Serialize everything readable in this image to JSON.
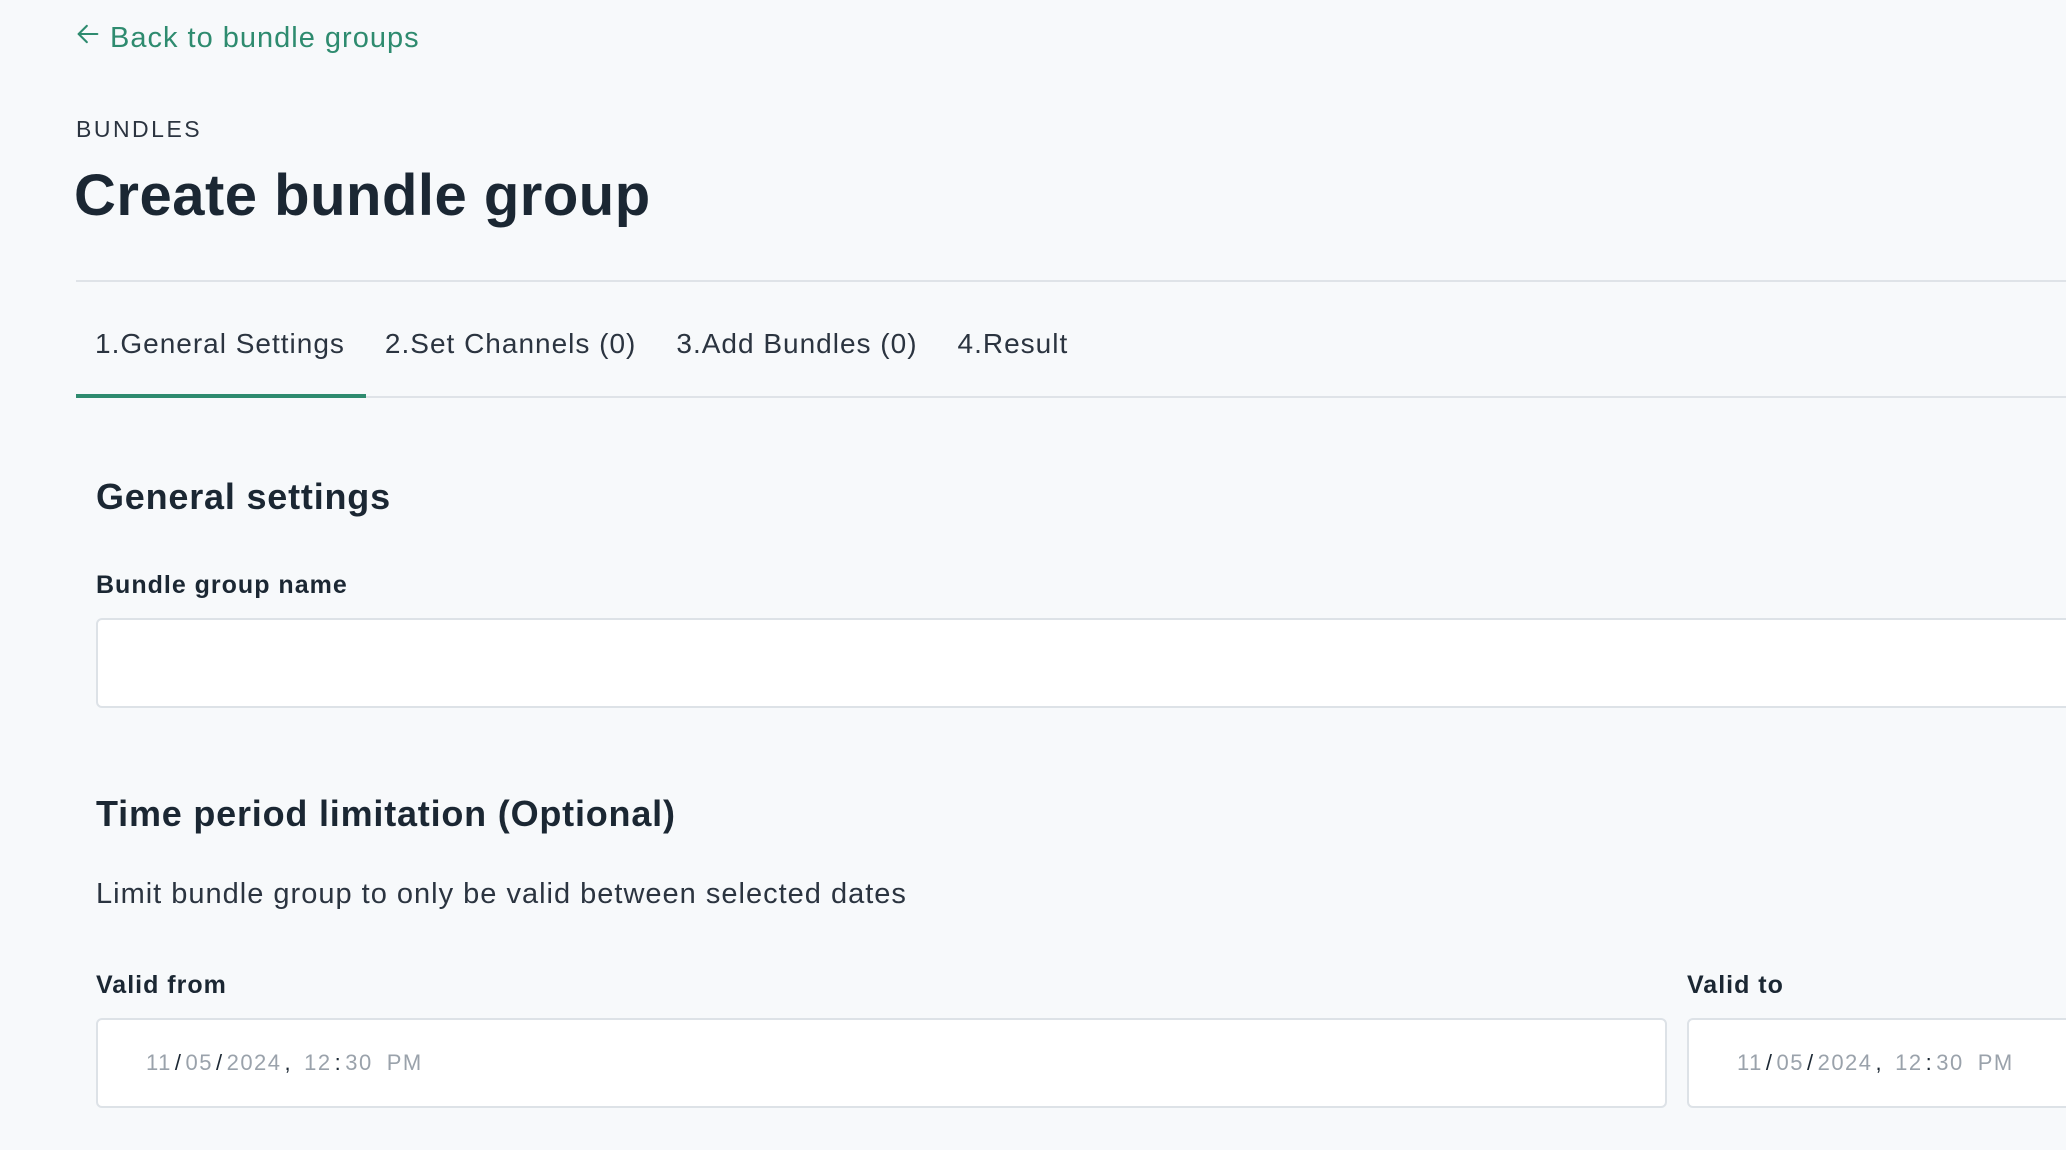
{
  "nav": {
    "back_label": "Back to bundle groups"
  },
  "header": {
    "eyebrow": "BUNDLES",
    "title": "Create bundle group"
  },
  "tabs": [
    {
      "label": "1.General Settings",
      "active": true
    },
    {
      "label": "2.Set Channels (0)",
      "active": false
    },
    {
      "label": "3.Add Bundles (0)",
      "active": false
    },
    {
      "label": "4.Result",
      "active": false
    }
  ],
  "general": {
    "heading": "General settings",
    "name_label": "Bundle group name",
    "name_value": ""
  },
  "time_period": {
    "heading": "Time period limitation (Optional)",
    "description": "Limit bundle group to only be valid between selected dates",
    "valid_from": {
      "label": "Valid from",
      "month": "11",
      "day": "05",
      "year": "2024",
      "hour": "12",
      "minute": "30",
      "ampm": "PM"
    },
    "valid_to": {
      "label": "Valid to",
      "month": "11",
      "day": "05",
      "year": "2024",
      "hour": "12",
      "minute": "30",
      "ampm": "PM"
    }
  },
  "colors": {
    "accent": "#2e8b6f",
    "background": "#f7f9fb",
    "border": "#dde2e7",
    "text": "#1b2733"
  },
  "icons": {
    "back": "arrow-left-icon"
  }
}
